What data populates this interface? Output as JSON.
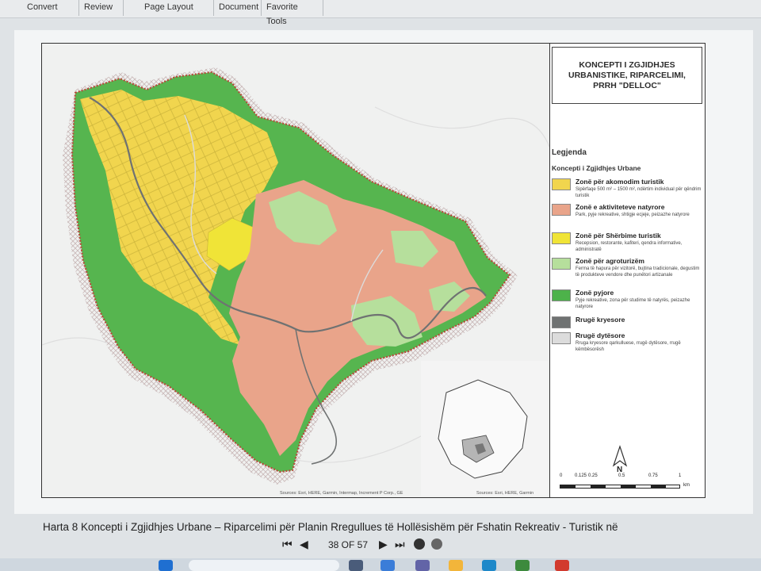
{
  "toolbar": {
    "tabs": [
      "Convert",
      "Review",
      "Page Layout",
      "Document",
      "Favorite Tools"
    ]
  },
  "map": {
    "title": "KONCEPTI I ZGJIDHJES URBANISTIKE, RIPARCELIMI, PRRH \"DELLOC\"",
    "legend_heading": "Legjenda",
    "legend_subheading": "Koncepti i Zgjidhjes Urbane",
    "legend_items": [
      {
        "name": "Zonë për akomodim turistik",
        "desc": "Sipërfaqe 500 m² – 1500 m², ndërtim individual për qëndrim turistik",
        "color": "#f1d54e"
      },
      {
        "name": "Zonë e aktiviteteve natyrore",
        "desc": "Park, pyje rekreative, shtigje ecjeje, peizazhe natyrore",
        "color": "#e9a48a"
      },
      {
        "name": "Zonë për Shërbime turistik",
        "desc": "Recepsion, restorante, kafiteri, qendra informative, administratë",
        "color": "#f0e437"
      },
      {
        "name": "Zonë për agroturizëm",
        "desc": "Ferma të hapura për vizitorë, bujtina tradicionale, degustim të produkteve vendore dhe punëtori artizanale",
        "color": "#b6df9c"
      },
      {
        "name": "Zonë pyjore",
        "desc": "Pyje rekreative, zona për studime të natyrës, peizazhe natyrore",
        "color": "#4db24a"
      },
      {
        "name": "Rrugë kryesore",
        "desc": "",
        "color": "#6f7272"
      },
      {
        "name": "Rrugë dytësore",
        "desc": "Rruga kryesore qarkulluese, rrugë dytësore, rrugë këmbësorësh",
        "color": "#dcdcdc"
      }
    ],
    "north_label": "N",
    "scale_labels": [
      "0",
      "0.125",
      "0.25",
      "0.5",
      "0.75",
      "1"
    ],
    "scale_unit": "km",
    "source_main": "Sources: Esri, HERE, Garmin, Intermap, Increment P Corp., GE",
    "source_inset": "Sources: Esri, HERE, Garmin"
  },
  "caption": "Harta 8 Koncepti i Zgjidhjes Urbane – Riparcelimi për Planin Rregullues të Hollësishëm për Fshatin Rekreativ - Turistik në",
  "navigation": {
    "page_indicator": "38 OF 57"
  }
}
